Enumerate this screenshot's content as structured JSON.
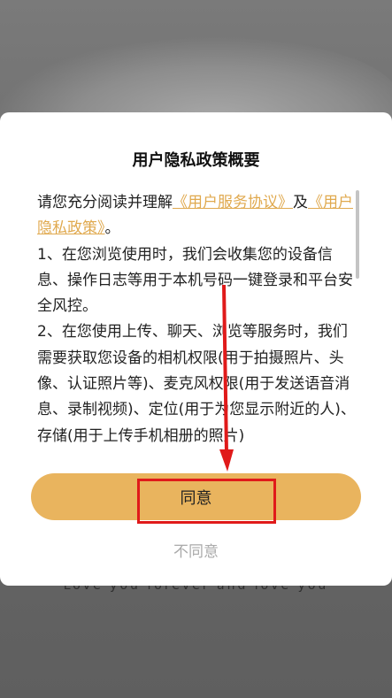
{
  "background": {
    "tagline": "Love you forever and love you"
  },
  "dialog": {
    "title": "用户隐私政策概要",
    "intro_prefix": "请您充分阅读并理解",
    "link_service": "《用户服务协议》",
    "intro_and": "及",
    "link_privacy": "《用户隐私政策》",
    "intro_end": "。",
    "paragraph1": "1、在您浏览使用时，我们会收集您的设备信息、操作日志等用于本机号码一键登录和平台安全风控。",
    "paragraph2": "2、在您使用上传、聊天、浏览等服务时，我们需要获取您设备的相机权限(用于拍摄照片、头像、认证照片等)、麦克风权限(用于发送语音消息、录制视频)、定位(用于为您显示附近的人)、存储(用于上传手机相册的照片)",
    "agree_label": "同意",
    "disagree_label": "不同意"
  },
  "colors": {
    "accent": "#e9b45e",
    "link": "#e0a94e",
    "annotation": "#e01a1a"
  }
}
